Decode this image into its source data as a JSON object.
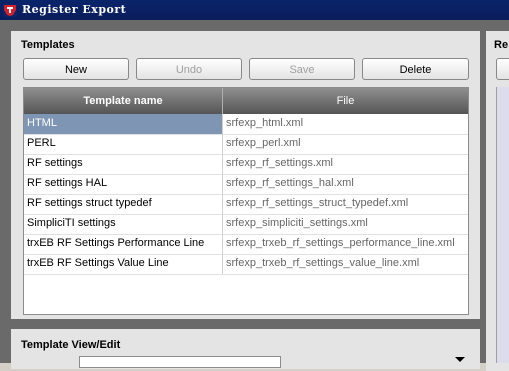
{
  "window": {
    "title": "Register Export"
  },
  "templates": {
    "header": "Templates",
    "buttons": {
      "new": "New",
      "undo": "Undo",
      "save": "Save",
      "delete": "Delete"
    },
    "columns": {
      "name": "Template name",
      "file": "File"
    },
    "rows": [
      {
        "name": "HTML",
        "file": "srfexp_html.xml"
      },
      {
        "name": "PERL",
        "file": "srfexp_perl.xml"
      },
      {
        "name": "RF settings",
        "file": "srfexp_rf_settings.xml"
      },
      {
        "name": "RF settings HAL",
        "file": "srfexp_rf_settings_hal.xml"
      },
      {
        "name": "RF settings struct typedef",
        "file": "srfexp_rf_settings_struct_typedef.xml"
      },
      {
        "name": "SimpliciTI settings",
        "file": "srfexp_simpliciti_settings.xml"
      },
      {
        "name": "trxEB RF Settings Performance Line",
        "file": "srfexp_trxeb_rf_settings_performance_line.xml"
      },
      {
        "name": "trxEB RF Settings Value Line",
        "file": "srfexp_trxeb_rf_settings_value_line.xml"
      }
    ],
    "selected_row": 0
  },
  "view_edit": {
    "header": "Template View/Edit"
  },
  "right_panel": {
    "header": "Re"
  }
}
